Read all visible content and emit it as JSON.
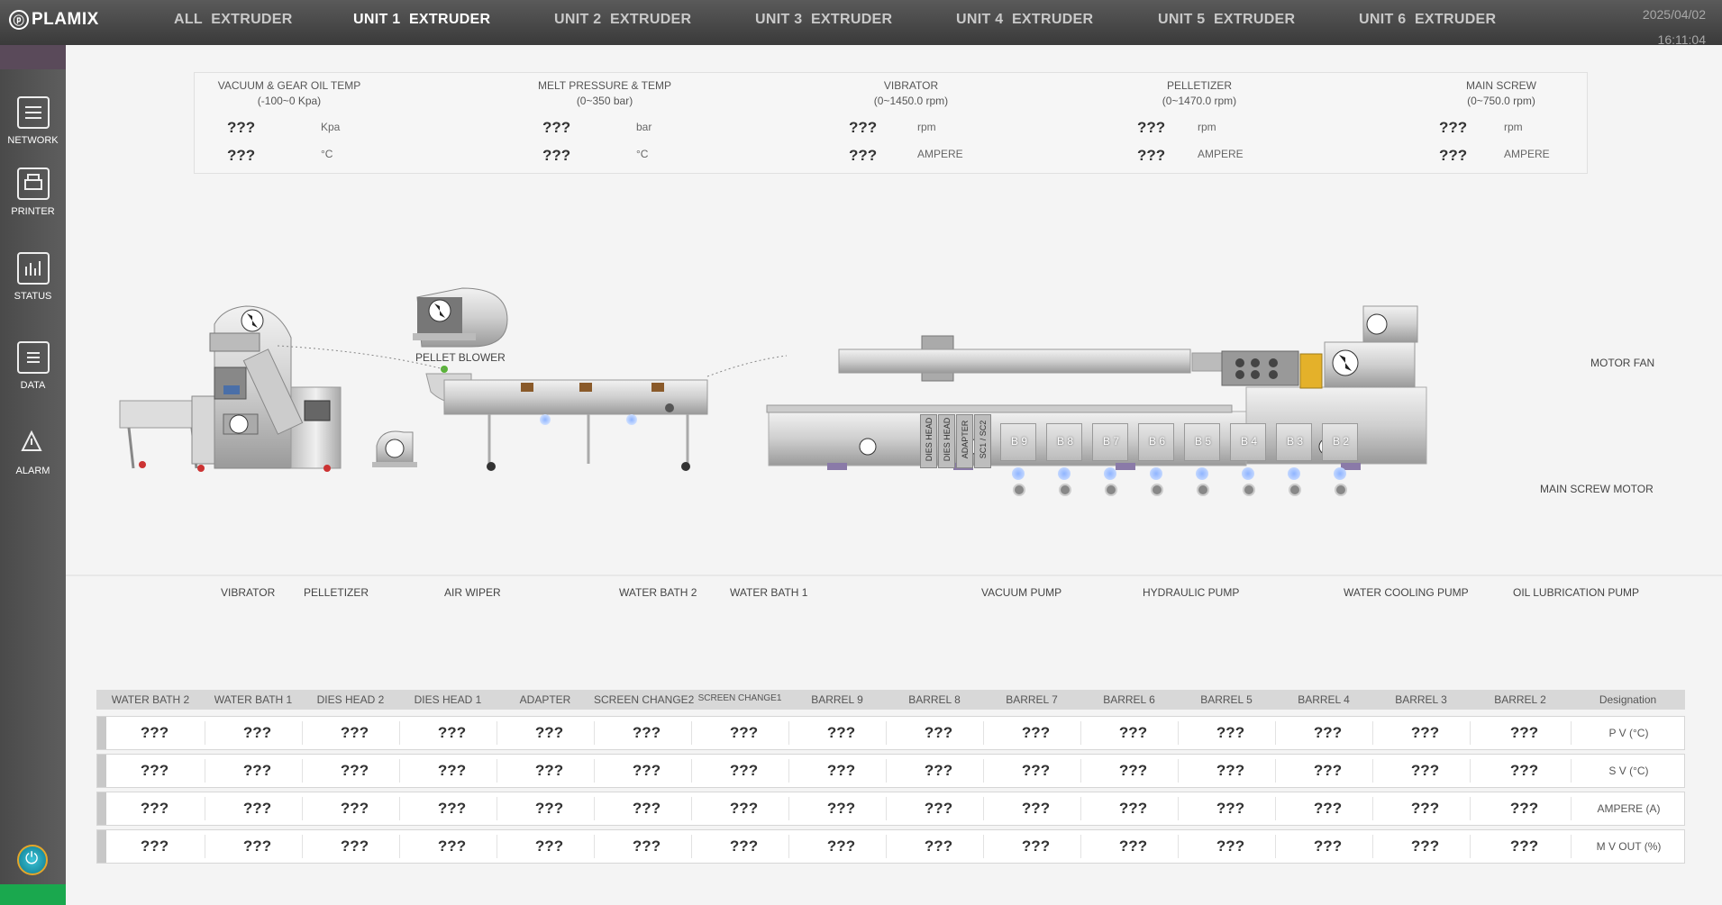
{
  "brand": "PLAMIX",
  "tabs": [
    "ALL  EXTRUDER",
    "UNIT 1  EXTRUDER",
    "UNIT 2  EXTRUDER",
    "UNIT 3  EXTRUDER",
    "UNIT 4  EXTRUDER",
    "UNIT 5  EXTRUDER",
    "UNIT 6  EXTRUDER"
  ],
  "active_tab": "UNIT 1  EXTRUDER",
  "date": "2025/04/02",
  "time": "16:11:04",
  "sidebar": [
    {
      "label": "NETWORK",
      "icon": "network-icon"
    },
    {
      "label": "PRINTER",
      "icon": "printer-icon"
    },
    {
      "label": "STATUS",
      "icon": "status-icon"
    },
    {
      "label": "DATA",
      "icon": "data-icon"
    },
    {
      "label": "ALARM",
      "icon": "alarm-icon"
    }
  ],
  "sensors": [
    {
      "title": "VACUUM & GEAR OIL TEMP",
      "range": "(-100~0 Kpa)",
      "value1": "???",
      "unit1": "Kpa",
      "value2": "???",
      "unit2": "°C"
    },
    {
      "title": "MELT  PRESSURE & TEMP",
      "range": "(0~350 bar)",
      "value1": "???",
      "unit1": "bar",
      "value2": "???",
      "unit2": "°C"
    },
    {
      "title": "VIBRATOR",
      "range": "(0~1450.0 rpm)",
      "value1": "???",
      "unit1": "rpm",
      "value2": "???",
      "unit2": "AMPERE"
    },
    {
      "title": "PELLETIZER",
      "range": "(0~1470.0 rpm)",
      "value1": "???",
      "unit1": "rpm",
      "value2": "???",
      "unit2": "AMPERE"
    },
    {
      "title": "MAIN SCREW",
      "range": "(0~750.0 rpm)",
      "value1": "???",
      "unit1": "rpm",
      "value2": "???",
      "unit2": "AMPERE"
    }
  ],
  "machine_labels": {
    "pellet_blower": "PELLET BLOWER",
    "motor_fan": "MOTOR FAN",
    "main_screw_motor": "MAIN SCREW MOTOR",
    "vibrator": "VIBRATOR",
    "pelletizer": "PELLETIZER",
    "air_wiper": "AIR WIPER",
    "water_bath_2": "WATER BATH 2",
    "water_bath_1": "WATER BATH 1",
    "vacuum_pump": "VACUUM PUMP",
    "hydraulic_pump": "HYDRAULIC PUMP",
    "water_cooling_pump": "WATER COOLING PUMP",
    "oil_lubrication_pump": "OIL LUBRICATION PUMP"
  },
  "head_blocks": [
    "DIES HEAD",
    "DIES HEAD",
    "ADAPTER",
    "SC1 / SC2"
  ],
  "barrels": [
    "B 9",
    "B 8",
    "B 7",
    "B 6",
    "B 5",
    "B 4",
    "B 3",
    "B 2"
  ],
  "table": {
    "columns": [
      "WATER BATH 2",
      "WATER BATH 1",
      "DIES HEAD 2",
      "DIES HEAD 1",
      "ADAPTER",
      "SCREEN CHANGE2",
      "SCREEN CHANGE1",
      "BARREL 9",
      "BARREL 8",
      "BARREL 7",
      "BARREL 6",
      "BARREL 5",
      "BARREL 4",
      "BARREL 3",
      "BARREL 2",
      "Designation"
    ],
    "rows": [
      {
        "designation": "P  V  (°C)",
        "values": [
          "???",
          "???",
          "???",
          "???",
          "???",
          "???",
          "???",
          "???",
          "???",
          "???",
          "???",
          "???",
          "???",
          "???",
          "???"
        ]
      },
      {
        "designation": "S  V  (°C)",
        "values": [
          "???",
          "???",
          "???",
          "???",
          "???",
          "???",
          "???",
          "???",
          "???",
          "???",
          "???",
          "???",
          "???",
          "???",
          "???"
        ]
      },
      {
        "designation": "AMPERE (A)",
        "values": [
          "???",
          "???",
          "???",
          "???",
          "???",
          "???",
          "???",
          "???",
          "???",
          "???",
          "???",
          "???",
          "???",
          "???",
          "???"
        ]
      },
      {
        "designation": "M V OUT (%)",
        "values": [
          "???",
          "???",
          "???",
          "???",
          "???",
          "???",
          "???",
          "???",
          "???",
          "???",
          "???",
          "???",
          "???",
          "???",
          "???"
        ]
      }
    ]
  }
}
